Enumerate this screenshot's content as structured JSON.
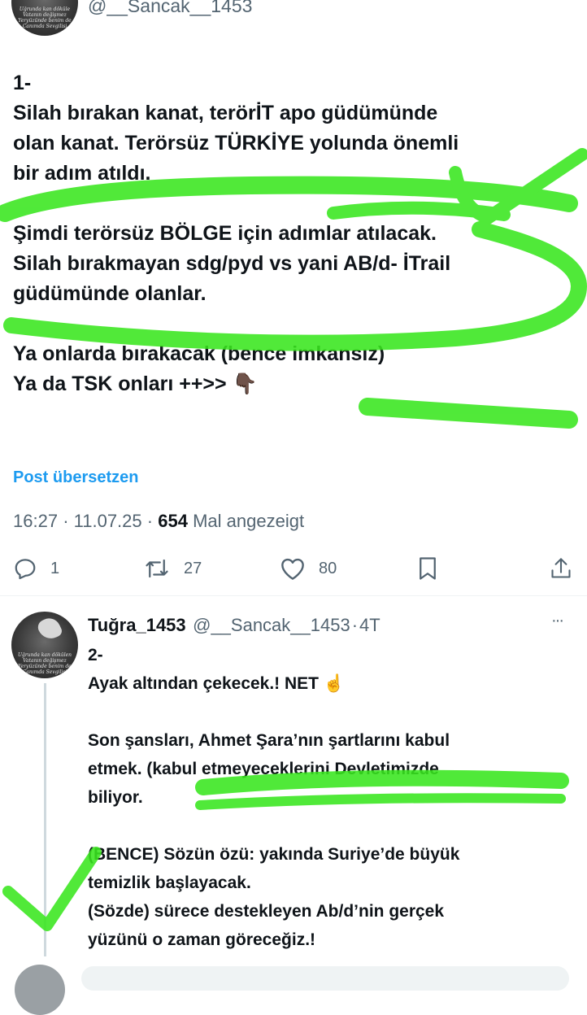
{
  "top_tweet": {
    "handle_partial": "@__Sancak__1453",
    "avatar_text": [
      "Uğrunda kan döküle",
      "Vatanın değişmez",
      "Yeryüzünde benim de",
      "Canımda Sevgilisi"
    ],
    "lines": [
      "1-",
      "Silah bırakan kanat, terörİT apo güdümünde",
      "olan kanat. Terörsüz TÜRKİYE yolunda önemli",
      "bir adım atıldı.",
      "Şimdi terörsüz BÖLGE için adımlar atılacak.",
      "Silah bırakmayan sdg/pyd vs yani AB/d- İTrail",
      "güdümünde olanlar.",
      "Ya onlarda bırakacak (bence imkansız)",
      "Ya da TSK onları ++>> 👇🏿"
    ],
    "translate_label": "Post übersetzen",
    "time": "16:27",
    "date": "11.07.25",
    "views_count": "654",
    "views_label": "Mal angezeigt",
    "separator": "·"
  },
  "actions": {
    "replies": "1",
    "reposts": "27",
    "likes": "80",
    "icons": [
      "reply-icon",
      "repost-icon",
      "like-icon",
      "bookmark-icon",
      "share-icon"
    ]
  },
  "reply_tweet": {
    "name": "Tuğra_1453",
    "handle": "@__Sancak__1453",
    "separator": "·",
    "age": "4T",
    "more": "···",
    "avatar_text": [
      "Uğrunda kan dökülen",
      "Vatanın değişmez",
      "Yeryüzünde benim de",
      "Canımda Sevgilisi"
    ],
    "lines": [
      "2-",
      "Ayak altından çekecek.! NET ☝️",
      "Son şansları, Ahmet Şara’nın şartlarını kabul",
      "etmek. (kabul etmeyeceklerini Devletimizde",
      "biliyor.",
      "(BENCE) Sözün özü: yakında Suriye’de büyük",
      "temizlik başlayacak.",
      "(Sözde) sürece destekleyen Ab/d’nin gerçek",
      "yüzünü o zaman göreceğiz.!"
    ]
  },
  "colors": {
    "highlight": "#39e61e",
    "link": "#1d9bf0",
    "secondary": "#536471",
    "text": "#0f1419"
  }
}
